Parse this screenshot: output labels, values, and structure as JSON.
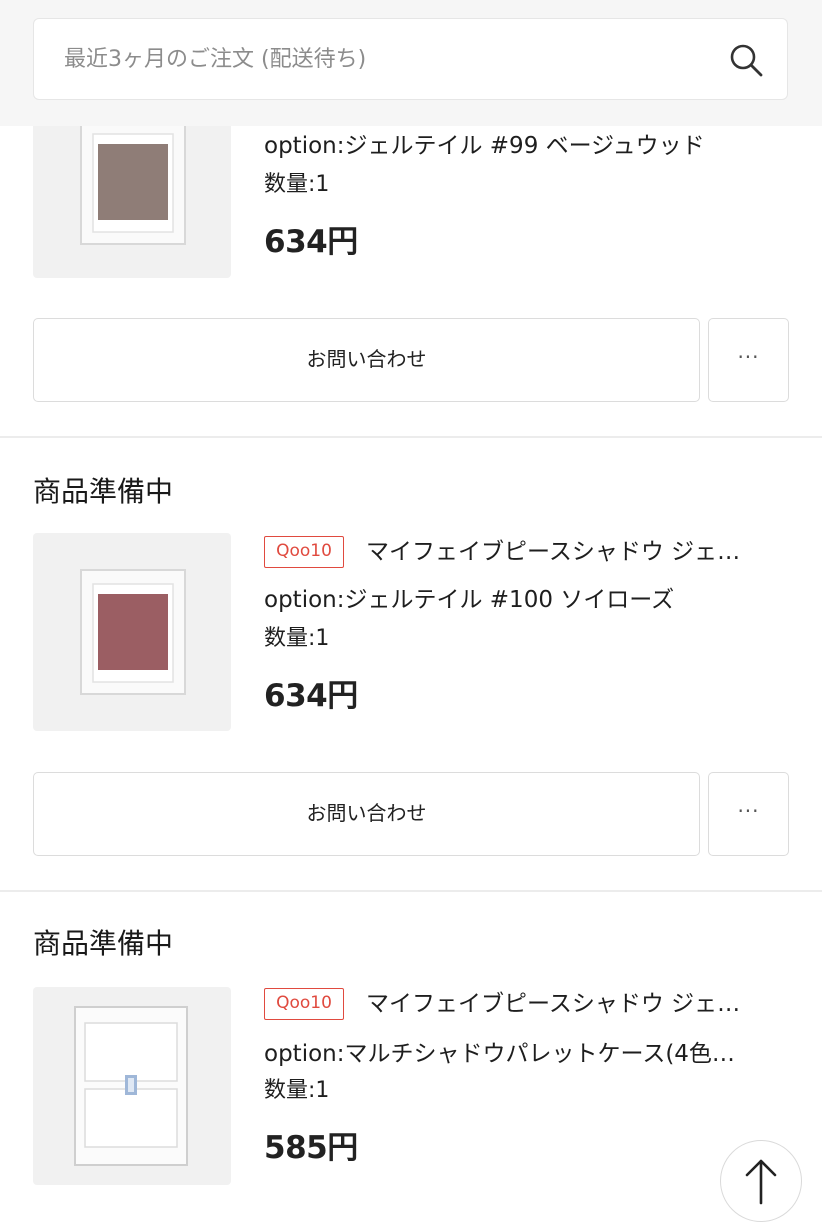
{
  "search": {
    "placeholder": "最近3ヶ月のご注文 (配送待ち)",
    "icon": "search-icon"
  },
  "colors": {
    "badge": "#e04a3f",
    "border": "#dcdcdc",
    "shadow_beige": "#8f7d77",
    "shadow_rose": "#9b5e63"
  },
  "orders": [
    {
      "option": "option:ジェルテイル #99 ベージュウッド",
      "quantity": "数量:1",
      "price": "634円",
      "inquiry_label": "お問い合わせ",
      "more_label": "···"
    },
    {
      "status": "商品準備中",
      "badge": "Qoo10",
      "title": "マイフェイブピースシャドウ ジェ…",
      "option": "option:ジェルテイル #100 ソイローズ",
      "quantity": "数量:1",
      "price": "634円",
      "inquiry_label": "お問い合わせ",
      "more_label": "···"
    },
    {
      "status": "商品準備中",
      "badge": "Qoo10",
      "title": "マイフェイブピースシャドウ ジェ…",
      "option": "option:マルチシャドウパレットケース(4色…",
      "quantity": "数量:1",
      "price": "585円"
    }
  ],
  "scroll_top_icon": "arrow-up-icon"
}
